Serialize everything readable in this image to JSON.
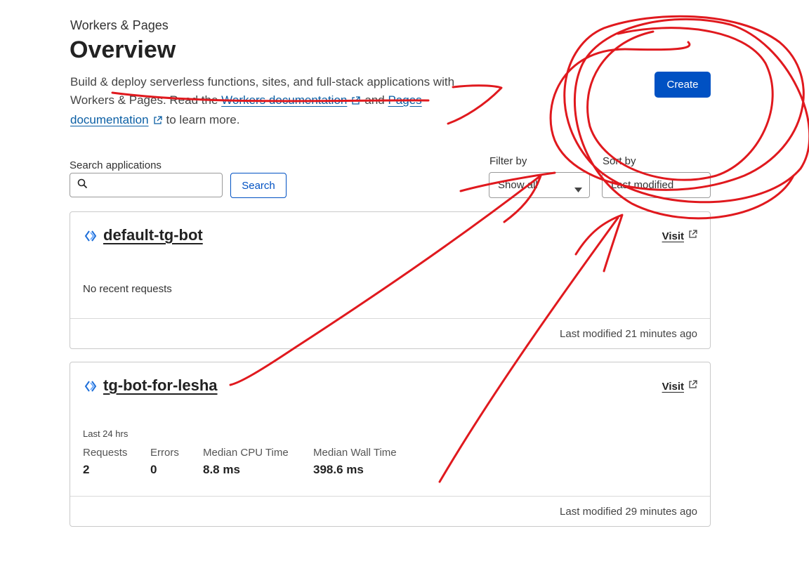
{
  "header": {
    "breadcrumb": "Workers & Pages",
    "title": "Overview",
    "intro_prefix": "Build & deploy serverless functions, sites, and full-stack applications with Workers & Pages. Read the",
    "workers_doc_link": "Workers documentation",
    "and_text": "and",
    "pages_doc_link": "Pages documentation",
    "intro_suffix": "to learn more.",
    "create_label": "Create"
  },
  "search": {
    "label": "Search applications",
    "value": "",
    "button_label": "Search"
  },
  "filter": {
    "label": "Filter by",
    "value": "Show all"
  },
  "sort": {
    "label": "Sort by",
    "value": "Last modified"
  },
  "apps": [
    {
      "name": "default-tg-bot",
      "visit_label": "Visit",
      "status": "No recent requests",
      "modified": "Last modified 21 minutes ago"
    },
    {
      "name": "tg-bot-for-lesha",
      "visit_label": "Visit",
      "period": "Last 24 hrs",
      "metrics": [
        {
          "label": "Requests",
          "value": "2"
        },
        {
          "label": "Errors",
          "value": "0"
        },
        {
          "label": "Median CPU Time",
          "value": "8.8 ms"
        },
        {
          "label": "Median Wall Time",
          "value": "398.6 ms"
        }
      ],
      "modified": "Last modified 29 minutes ago"
    }
  ],
  "colors": {
    "primary": "#0051c3",
    "link": "#0b5fa5",
    "annotation": "#e0191e"
  }
}
